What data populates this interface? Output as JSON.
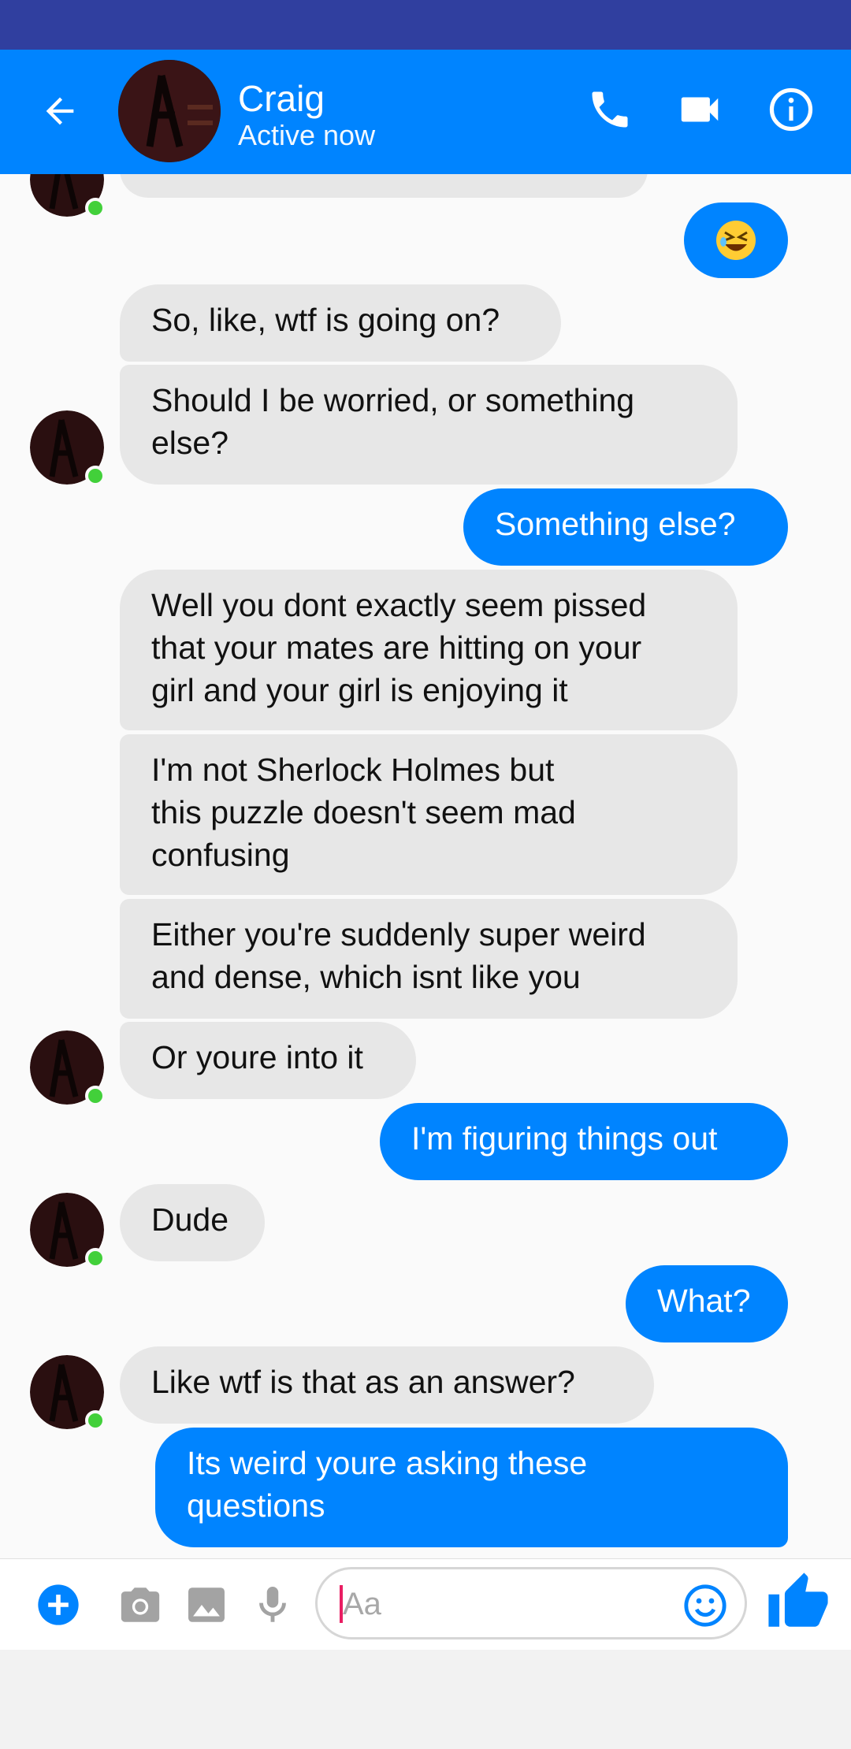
{
  "header": {
    "contact_name": "Craig",
    "status": "Active now"
  },
  "messages": [
    {
      "from": "them",
      "text": ""
    },
    {
      "from": "me",
      "emoji": "rolling-laughing-emoji"
    },
    {
      "from": "them",
      "text": "So, like, wtf is going on?"
    },
    {
      "from": "them",
      "lines": [
        "Should I be worried, or something",
        "else?"
      ]
    },
    {
      "from": "me",
      "text": "Something else?"
    },
    {
      "from": "them",
      "lines": [
        "Well you dont exactly seem pissed",
        "that your mates are hitting on your",
        "girl and your girl is enjoying it"
      ]
    },
    {
      "from": "them",
      "lines": [
        "I'm not Sherlock Holmes but",
        "this puzzle doesn't seem mad",
        "confusing"
      ]
    },
    {
      "from": "them",
      "lines": [
        "Either you're suddenly super weird",
        "and dense, which isnt like you"
      ]
    },
    {
      "from": "them",
      "text": "Or youre into it"
    },
    {
      "from": "me",
      "text": "I'm figuring things out"
    },
    {
      "from": "them",
      "text": "Dude"
    },
    {
      "from": "me",
      "text": "What?"
    },
    {
      "from": "them",
      "text": "Like wtf is that as an answer?"
    },
    {
      "from": "me",
      "lines": [
        "Its weird youre asking these",
        "questions"
      ]
    }
  ],
  "composer": {
    "placeholder": "Aa",
    "value": ""
  },
  "colors": {
    "status_bar": "#303f9f",
    "header": "#0084ff",
    "outgoing_bubble": "#0084ff",
    "incoming_bubble": "#e7e7e7",
    "online": "#42d03a"
  },
  "icons": {
    "header": [
      "back-arrow-icon",
      "phone-icon",
      "video-camera-icon",
      "info-icon"
    ],
    "composer": [
      "plus-icon",
      "camera-icon",
      "image-icon",
      "microphone-icon",
      "emoji-icon",
      "thumbs-up-icon"
    ]
  }
}
